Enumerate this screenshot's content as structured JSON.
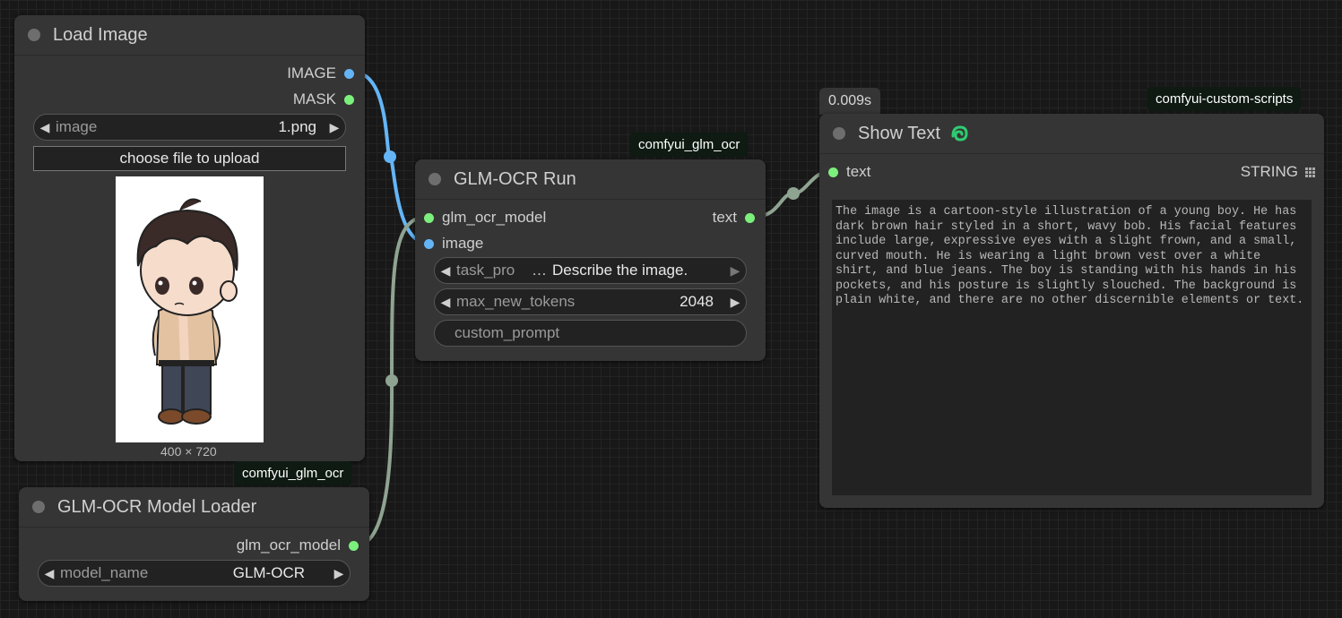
{
  "colors": {
    "image_link": "#64b5f6",
    "model_link": "#8fa391",
    "text_link": "#8fa391",
    "mask_port": "#7cf07c",
    "badge_bg": "#0e1a12"
  },
  "load_image": {
    "title": "Load Image",
    "outputs": [
      "IMAGE",
      "MASK"
    ],
    "image_widget": {
      "label": "image",
      "value": "1.png"
    },
    "upload_label": "choose file to upload",
    "preview_dims": "400 × 720"
  },
  "glm_loader": {
    "badge": "comfyui_glm_ocr",
    "title": "GLM-OCR Model Loader",
    "output": "glm_ocr_model",
    "model_widget": {
      "label": "model_name",
      "value": "GLM-OCR"
    }
  },
  "glm_run": {
    "badge": "comfyui_glm_ocr",
    "title": "GLM-OCR Run",
    "inputs": [
      "glm_ocr_model",
      "image"
    ],
    "output": "text",
    "task_widget": {
      "label": "task_pro",
      "ellipsis": "…",
      "value": "Describe the image."
    },
    "tokens_widget": {
      "label": "max_new_tokens",
      "value": "2048"
    },
    "custom_prompt_placeholder": "custom_prompt"
  },
  "show_text": {
    "timer": "0.009s",
    "badge": "comfyui-custom-scripts",
    "title": "Show Text",
    "icon": "snake-icon",
    "input": "text",
    "type_label": "STRING",
    "content": "The image is a cartoon-style illustration of a young boy. He has dark brown hair styled in a short, wavy bob. His facial features include large, expressive eyes with a slight frown, and a small, curved mouth. He is wearing a light brown vest over a white shirt, and blue jeans. The boy is standing with his hands in his pockets, and his posture is slightly slouched. The background is plain white, and there are no other discernible elements or text."
  }
}
